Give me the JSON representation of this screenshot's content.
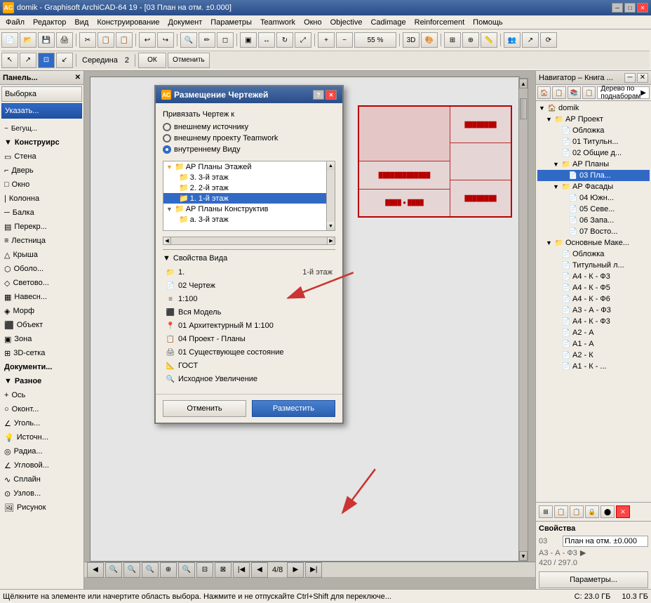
{
  "titleBar": {
    "icon": "AC",
    "text": "domik - Graphisoft ArchiCAD-64 19 - [03 План на отм. ±0.000]",
    "minimize": "─",
    "maximize": "□",
    "close": "✕"
  },
  "menuBar": {
    "items": [
      "Файл",
      "Редактор",
      "Вид",
      "Конструирование",
      "Документ",
      "Параметры",
      "Teamwork",
      "Окно",
      "Objective",
      "Cadimage",
      "Reinforcement",
      "Помощь"
    ]
  },
  "toolbar": {
    "zoom": "55 %",
    "page": "4/8",
    "middleLabel": "Середина",
    "middleVal": "2",
    "ok": "ОК",
    "cancel": "Отменить"
  },
  "leftPanel": {
    "header": "Панель...",
    "selectionBtn": "Выборка",
    "pointerBtn": "Указать...",
    "items": [
      {
        "label": "Бегущ...",
        "icon": "~",
        "group": false
      },
      {
        "label": "Конструирс",
        "icon": "▼",
        "group": true
      },
      {
        "label": "Стена",
        "icon": "▭",
        "group": false
      },
      {
        "label": "Дверь",
        "icon": "⌐",
        "group": false
      },
      {
        "label": "Окно",
        "icon": "□",
        "group": false
      },
      {
        "label": "Колонна",
        "icon": "|",
        "group": false
      },
      {
        "label": "Балка",
        "icon": "─",
        "group": false
      },
      {
        "label": "Перекр...",
        "icon": "▤",
        "group": false
      },
      {
        "label": "Лестница",
        "icon": "≡",
        "group": false
      },
      {
        "label": "Крыша",
        "icon": "△",
        "group": false
      },
      {
        "label": "Оболо...",
        "icon": "⬡",
        "group": false
      },
      {
        "label": "Светово...",
        "icon": "◇",
        "group": false
      },
      {
        "label": "Навесн...",
        "icon": "▦",
        "group": false
      },
      {
        "label": "Морф",
        "icon": "◈",
        "group": false
      },
      {
        "label": "Объект",
        "icon": "⬛",
        "group": false
      },
      {
        "label": "Зона",
        "icon": "▣",
        "group": false
      },
      {
        "label": "3D-сетка",
        "icon": "⊞",
        "group": false
      },
      {
        "label": "Документи...",
        "icon": "📄",
        "group": true
      },
      {
        "label": "Разное",
        "icon": "▼",
        "group": true
      },
      {
        "label": "Ось",
        "icon": "+",
        "group": false
      },
      {
        "label": "Оконт...",
        "icon": "○",
        "group": false
      },
      {
        "label": "Уголь...",
        "icon": "∠",
        "group": false
      },
      {
        "label": "Источн...",
        "icon": "💡",
        "group": false
      },
      {
        "label": "Радиа...",
        "icon": "◎",
        "group": false
      },
      {
        "label": "Угловой...",
        "icon": "∠",
        "group": false
      },
      {
        "label": "Сплайн",
        "icon": "∿",
        "group": false
      },
      {
        "label": "Узлов...",
        "icon": "⊙",
        "group": false
      },
      {
        "label": "Рисунок",
        "icon": "🖼",
        "group": false
      }
    ]
  },
  "dialog": {
    "title": "Размещение Чертежей",
    "sectionTitle": "Привязать Чертеж к",
    "radio1": "внешнему источнику",
    "radio2": "внешнему проекту Teamwork",
    "radio3": "внутреннему Виду",
    "tree": {
      "items": [
        {
          "label": "АР Планы Этажей",
          "indent": 1,
          "type": "folder",
          "expanded": true
        },
        {
          "label": "3. 3-й этаж",
          "indent": 2,
          "type": "folder"
        },
        {
          "label": "2. 2-й этаж",
          "indent": 2,
          "type": "folder"
        },
        {
          "label": "1. 1-й этаж",
          "indent": 2,
          "type": "folder",
          "selected": true
        },
        {
          "label": "АР Планы Конструктив",
          "indent": 1,
          "type": "folder",
          "expanded": true
        },
        {
          "label": "а. 3-й этаж",
          "indent": 2,
          "type": "folder"
        }
      ]
    },
    "propsSection": {
      "title": "Свойства Вида",
      "props": [
        {
          "icon": "📁",
          "label": "1.",
          "value": "1-й этаж"
        },
        {
          "icon": "📄",
          "label": "02 Чертеж",
          "value": ""
        },
        {
          "icon": "≡",
          "label": "1:100",
          "value": ""
        },
        {
          "icon": "⬛",
          "label": "Вся Модель",
          "value": ""
        },
        {
          "icon": "📍",
          "label": "01 Архитектурный М 1:100",
          "value": ""
        },
        {
          "icon": "📋",
          "label": "04 Проект - Планы",
          "value": ""
        },
        {
          "icon": "🖨",
          "label": "01 Существующее состояние",
          "value": ""
        },
        {
          "icon": "📐",
          "label": "ГОСТ",
          "value": ""
        },
        {
          "icon": "🔍",
          "label": "Исходное Увеличение",
          "value": ""
        }
      ]
    },
    "cancelBtn": "Отменить",
    "placeBtn": "Разместить"
  },
  "rightPanel": {
    "header": "Навигатор – Книга ...",
    "dropdownLabel": "Дерево по поднаборам",
    "tree": {
      "items": [
        {
          "label": "domik",
          "indent": 0,
          "type": "root",
          "expanded": true
        },
        {
          "label": "АР Проект",
          "indent": 1,
          "type": "folder",
          "expanded": true
        },
        {
          "label": "Обложка",
          "indent": 2,
          "type": "page"
        },
        {
          "label": "01 Титульн...",
          "indent": 2,
          "type": "page"
        },
        {
          "label": "02 Общие д...",
          "indent": 2,
          "type": "page"
        },
        {
          "label": "АР Планы",
          "indent": 2,
          "type": "folder",
          "expanded": true
        },
        {
          "label": "03 Пла...",
          "indent": 3,
          "type": "page",
          "selected": true
        },
        {
          "label": "АР Фасады",
          "indent": 2,
          "type": "folder",
          "expanded": true
        },
        {
          "label": "04 Южн...",
          "indent": 3,
          "type": "page"
        },
        {
          "label": "05 Севе...",
          "indent": 3,
          "type": "page"
        },
        {
          "label": "06 Запа...",
          "indent": 3,
          "type": "page"
        },
        {
          "label": "07 Восто...",
          "indent": 3,
          "type": "page"
        },
        {
          "label": "Основные Маке...",
          "indent": 1,
          "type": "folder",
          "expanded": true
        },
        {
          "label": "Обложка",
          "indent": 2,
          "type": "page"
        },
        {
          "label": "Титульный л...",
          "indent": 2,
          "type": "page"
        },
        {
          "label": "А4 - К - Ф3",
          "indent": 2,
          "type": "page"
        },
        {
          "label": "А4 - К - Ф5",
          "indent": 2,
          "type": "page"
        },
        {
          "label": "А4 - К - Ф6",
          "indent": 2,
          "type": "page"
        },
        {
          "label": "А3 - А - Ф3",
          "indent": 2,
          "type": "page"
        },
        {
          "label": "А4 - К - Ф3",
          "indent": 2,
          "type": "page"
        },
        {
          "label": "А2 - А",
          "indent": 2,
          "type": "page"
        },
        {
          "label": "А1 - А",
          "indent": 2,
          "type": "page"
        },
        {
          "label": "А2 - К",
          "indent": 2,
          "type": "page"
        },
        {
          "label": "А1 - К - ...",
          "indent": 2,
          "type": "page"
        }
      ]
    },
    "bottomBtns": [
      "⊞",
      "📋",
      "📋",
      "🔒",
      "⬤",
      "✕"
    ],
    "properties": {
      "header": "Свойства",
      "rows": [
        {
          "label": "03",
          "value": "План на отм. ±0.000"
        },
        {
          "label": "А3 - А - Ф3",
          "value": "▶"
        },
        {
          "label": "420 / 297.0",
          "value": ""
        }
      ],
      "paramBtn": "Параметры..."
    }
  },
  "statusBar": {
    "left": "Щёлкните на элементе или начертите область выбора. Нажмите и не отпускайте Ctrl+Shift для переключе...",
    "disk1": "С: 23.0 ГБ",
    "disk2": "10.3 ГБ"
  }
}
